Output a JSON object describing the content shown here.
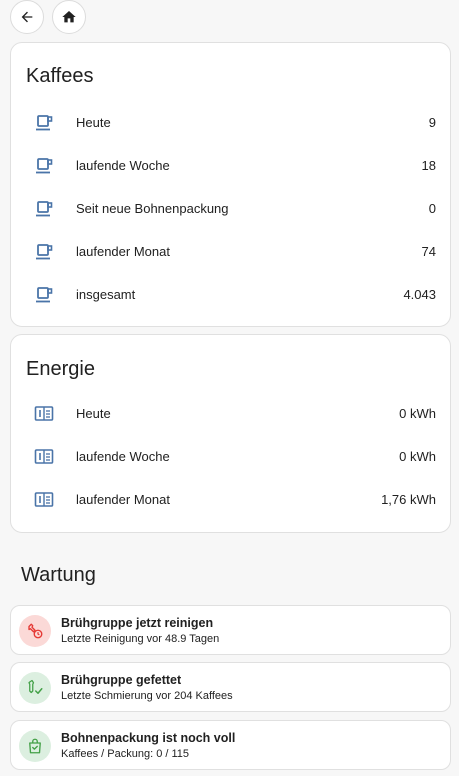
{
  "colors": {
    "icon_blue": "#4a74a8",
    "badge_red_bg": "#fbd9d7",
    "badge_red_icon": "#e53935",
    "badge_green_bg": "#dcefe0",
    "badge_green_icon": "#43a047"
  },
  "nav": {
    "back_icon": "arrow-left-icon",
    "home_icon": "home-icon"
  },
  "kaffees": {
    "title": "Kaffees",
    "rows": [
      {
        "label": "Heute",
        "value": "9"
      },
      {
        "label": "laufende Woche",
        "value": "18"
      },
      {
        "label": "Seit neue Bohnenpackung",
        "value": "0"
      },
      {
        "label": "laufender Monat",
        "value": "74"
      },
      {
        "label": "insgesamt",
        "value": "4.043"
      }
    ]
  },
  "energie": {
    "title": "Energie",
    "rows": [
      {
        "label": "Heute",
        "value": "0 kWh"
      },
      {
        "label": "laufende Woche",
        "value": "0 kWh"
      },
      {
        "label": "laufender Monat",
        "value": "1,76 kWh"
      }
    ]
  },
  "wartung": {
    "title": "Wartung",
    "items": [
      {
        "title": "Brühgruppe jetzt reinigen",
        "subtitle": "Letzte Reinigung vor 48.9 Tagen",
        "icon": "wrench-clock-icon",
        "status": "red"
      },
      {
        "title": "Brühgruppe gefettet",
        "subtitle": "Letzte Schmierung vor 204 Kaffees",
        "icon": "wrench-check-icon",
        "status": "green"
      },
      {
        "title": "Bohnenpackung ist noch voll",
        "subtitle": "Kaffees / Packung: 0 / 115",
        "icon": "shopping-bag-check-icon",
        "status": "green"
      }
    ]
  }
}
